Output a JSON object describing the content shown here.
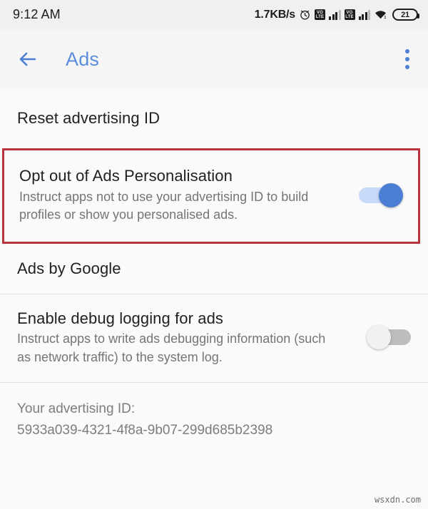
{
  "status_bar": {
    "clock": "9:12 AM",
    "network_speed": "1.7KB/s",
    "alarm_icon": "alarm-clock-icon",
    "sim1_volte_top": "VO",
    "sim1_volte_bottom": "LTE",
    "sim2_volte_top": "VO",
    "sim2_volte_bottom": "LTE",
    "wifi_icon": "wifi-icon",
    "battery_level": "21"
  },
  "app_bar": {
    "back_icon": "back-arrow-icon",
    "title": "Ads",
    "overflow_icon": "overflow-menu-icon",
    "title_color": "#5b8ddb"
  },
  "settings": {
    "reset_ad_id": {
      "title": "Reset advertising ID"
    },
    "opt_out": {
      "title": "Opt out of Ads Personalisation",
      "summary": "Instruct apps not to use your advertising ID to build profiles or show you personalised ads.",
      "toggle_state": "on",
      "highlighted": true,
      "highlight_color": "#b5343e"
    },
    "ads_by_google": {
      "title": "Ads by Google"
    },
    "debug_logging": {
      "title": "Enable debug logging for ads",
      "summary": "Instruct apps to write ads debugging information (such as network traffic) to the system log.",
      "toggle_state": "off"
    },
    "advertising_id": {
      "label": "Your advertising ID:",
      "value": "5933a039-4321-4f8a-9b07-299d685b2398"
    }
  },
  "watermark": "wsxdn.com",
  "colors": {
    "accent": "#4a7fd4",
    "toggle_on_track": "#c8d8f7",
    "toggle_off_track": "#bdbdbd",
    "background": "#fafafa"
  }
}
